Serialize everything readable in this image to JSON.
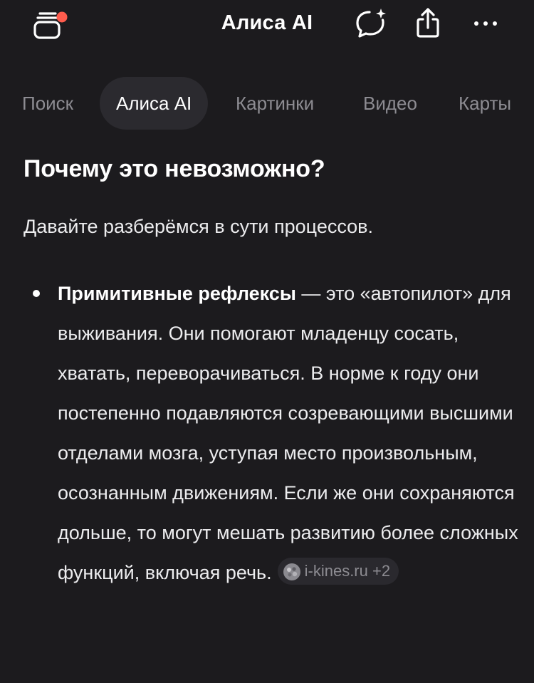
{
  "header": {
    "title": "Алиса AI",
    "icons": {
      "tabs": "tabs-stack-icon",
      "new_chat": "chat-sparkle-icon",
      "share": "share-icon",
      "more": "more-dots-icon"
    },
    "notification_color": "#ff5c4d"
  },
  "verticals": {
    "items": [
      {
        "label": "Поиск",
        "active": false
      },
      {
        "label": "Алиса AI",
        "active": true
      },
      {
        "label": "Картинки",
        "active": false
      },
      {
        "label": "Видео",
        "active": false
      },
      {
        "label": "Карты",
        "active": false
      }
    ]
  },
  "article": {
    "heading": "Почему это невозможно?",
    "intro": "Давайте разберёмся в сути процессов.",
    "bullet": {
      "bold": "Примитивные рефлексы",
      "text": " — это «автопилот» для выживания. Они помогают младенцу сосать, хватать, переворачиваться. В норме к году они постепенно подавляются созревающими высшими отделами мозга, уступая место произвольным, осознанным движениям. Если же они сохраняются дольше, то могут мешать развитию более сложных функций, включая речь.",
      "source": "i-kines.ru +2"
    }
  },
  "colors": {
    "background": "#1c1b1e",
    "active_tab_bg": "#2b2a2f",
    "muted_text": "#8d8c92"
  }
}
